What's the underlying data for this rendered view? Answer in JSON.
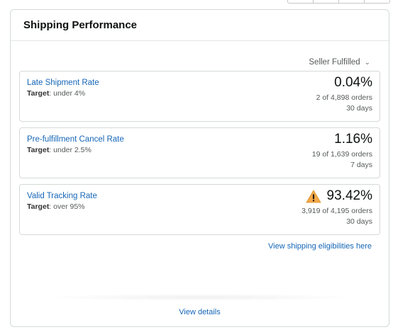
{
  "card": {
    "title": "Shipping Performance",
    "filter_label": "Seller Fulfilled",
    "filter_icon": "chevron-down-icon"
  },
  "metrics": [
    {
      "name": "Late Shipment Rate",
      "target_label": "Target",
      "target_value": ": under 4%",
      "value": "0.04%",
      "orders": "2 of 4,898 orders",
      "period": "30 days",
      "warning": false
    },
    {
      "name": "Pre-fulfillment Cancel Rate",
      "target_label": "Target",
      "target_value": ": under 2.5%",
      "value": "1.16%",
      "orders": "19 of 1,639 orders",
      "period": "7 days",
      "warning": false
    },
    {
      "name": "Valid Tracking Rate",
      "target_label": "Target",
      "target_value": ": over 95%",
      "value": "93.42%",
      "orders": "3,919 of 4,195 orders",
      "period": "30 days",
      "warning": true
    }
  ],
  "eligibility_link": "View shipping eligibilities here",
  "view_details": "View details",
  "colors": {
    "link": "#1566b7",
    "warning": "#f3a847",
    "border": "#d5d9d9"
  }
}
